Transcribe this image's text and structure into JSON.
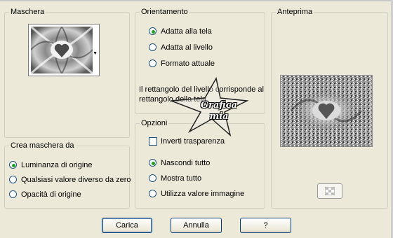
{
  "maschera": {
    "legend": "Maschera"
  },
  "orientamento": {
    "legend": "Orientamento",
    "options": [
      "Adatta alla tela",
      "Adatta al livello",
      "Formato attuale"
    ],
    "selected": "Adatta alla tela",
    "info": "Il rettangolo del livello corrisponde al rettangolo della tela."
  },
  "anteprima": {
    "legend": "Anteprima"
  },
  "crea": {
    "legend": "Crea maschera da",
    "options": [
      "Luminanza di origine",
      "Qualsiasi valore diverso da zero",
      "Opacità di origine"
    ],
    "selected": "Luminanza di origine"
  },
  "opzioni": {
    "legend": "Opzioni",
    "invert_label": "Inverti trasparenza",
    "invert_checked": false,
    "options": [
      "Nascondi tutto",
      "Mostra tutto",
      "Utilizza valore immagine"
    ],
    "selected": "Nascondi tutto"
  },
  "buttons": {
    "carica": "Carica",
    "annulla": "Annulla",
    "help": "?"
  },
  "watermark": {
    "line1": "Grafica",
    "line2": "mia"
  },
  "colors": {
    "dialog_bg": "#ece9d8",
    "radio_dot": "#21a121",
    "control_border": "#1c5180"
  },
  "icons": {
    "dropdown": "triangle-down",
    "preview_toggle": "checkerboard"
  }
}
